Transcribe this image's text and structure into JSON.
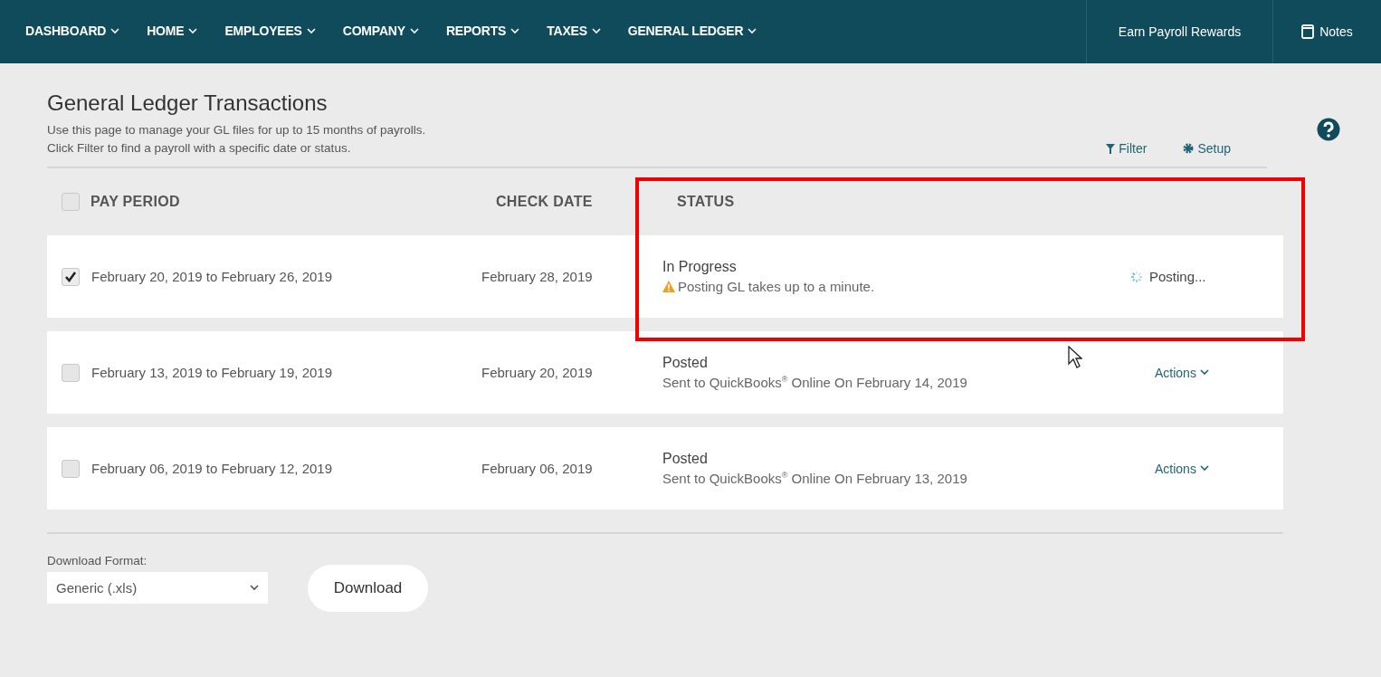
{
  "nav": {
    "items": [
      {
        "label": "DASHBOARD"
      },
      {
        "label": "HOME"
      },
      {
        "label": "EMPLOYEES"
      },
      {
        "label": "COMPANY"
      },
      {
        "label": "REPORTS"
      },
      {
        "label": "TAXES"
      },
      {
        "label": "GENERAL LEDGER"
      }
    ],
    "rewards": "Earn Payroll Rewards",
    "notes": "Notes"
  },
  "page": {
    "title": "General Ledger Transactions",
    "description": [
      "Use this page to manage your GL files for up to 15 months of payrolls.",
      "Click Filter to find a payroll with a specific date or status."
    ],
    "filter": "Filter",
    "setup": "Setup"
  },
  "table": {
    "select_all": {
      "checked": false
    },
    "columns": [
      "PAY PERIOD",
      "CHECK DATE",
      "STATUS"
    ],
    "rows": [
      {
        "kind": "progress",
        "checked": true,
        "pay_period": "February 20, 2019 to February 26, 2019",
        "check_date": "February 28, 2019",
        "status": "In Progress",
        "detail": "Posting GL takes up to a minute.",
        "action": "Posting..."
      },
      {
        "kind": "posted",
        "checked": false,
        "pay_period": "February 13, 2019 to February 19, 2019",
        "check_date": "February 20, 2019",
        "status": "Posted",
        "detail": "Sent to QuickBooks$^{®}$ Online On February 14, 2019",
        "action": "Actions"
      },
      {
        "kind": "posted",
        "checked": false,
        "pay_period": "February 06, 2019 to February 12, 2019",
        "check_date": "February 06, 2019",
        "status": "Posted",
        "detail": "Sent to QuickBooks$^{®}$ Online On February 13, 2019",
        "action": "Actions"
      }
    ]
  },
  "download": {
    "label": "Download Format:",
    "format": "Generic (.xls)",
    "button": "Download"
  }
}
